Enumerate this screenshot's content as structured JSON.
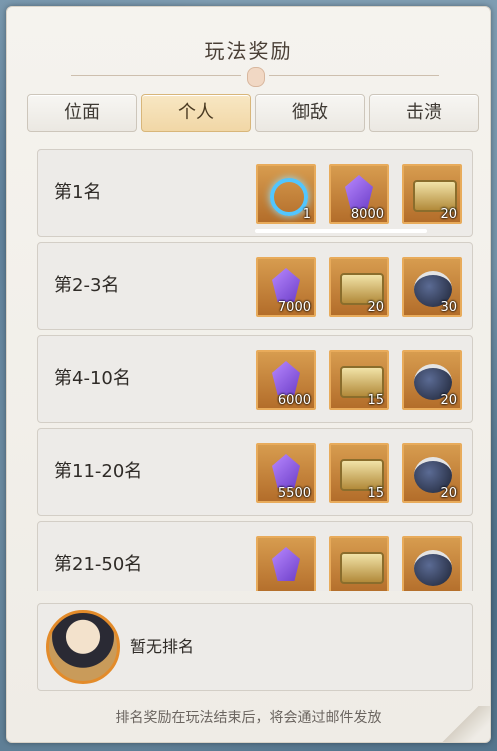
{
  "window": {
    "title": "玩法奖励"
  },
  "tabs": [
    {
      "label": "位面",
      "active": false
    },
    {
      "label": "个人",
      "active": true
    },
    {
      "label": "御敌",
      "active": false
    },
    {
      "label": "击溃",
      "active": false
    }
  ],
  "rows": [
    {
      "rank": "第1名",
      "items": [
        {
          "icon": "blue-ring-icon",
          "qty": "1"
        },
        {
          "icon": "purple-crystal-icon",
          "qty": "8000"
        },
        {
          "icon": "treasure-chest-icon",
          "qty": "20"
        }
      ]
    },
    {
      "rank": "第2-3名",
      "items": [
        {
          "icon": "purple-crystal-icon",
          "qty": "7000"
        },
        {
          "icon": "treasure-chest-icon",
          "qty": "20"
        },
        {
          "icon": "dark-orb-icon",
          "qty": "30"
        }
      ]
    },
    {
      "rank": "第4-10名",
      "items": [
        {
          "icon": "purple-crystal-icon",
          "qty": "6000"
        },
        {
          "icon": "treasure-chest-icon",
          "qty": "15"
        },
        {
          "icon": "dark-orb-icon",
          "qty": "20"
        }
      ]
    },
    {
      "rank": "第11-20名",
      "items": [
        {
          "icon": "purple-crystal-icon",
          "qty": "5500"
        },
        {
          "icon": "treasure-chest-icon",
          "qty": "15"
        },
        {
          "icon": "dark-orb-icon",
          "qty": "20"
        }
      ]
    },
    {
      "rank": "第21-50名",
      "items": [
        {
          "icon": "purple-crystal-icon",
          "qty": ""
        },
        {
          "icon": "treasure-chest-icon",
          "qty": ""
        },
        {
          "icon": "dark-orb-icon",
          "qty": ""
        }
      ]
    }
  ],
  "self": {
    "status": "暂无排名"
  },
  "footer": {
    "note": "排名奖励在玩法结束后，将会通过邮件发放"
  },
  "colors": {
    "accent": "#e8ab5b",
    "active_tab": "#f1d7a6"
  }
}
